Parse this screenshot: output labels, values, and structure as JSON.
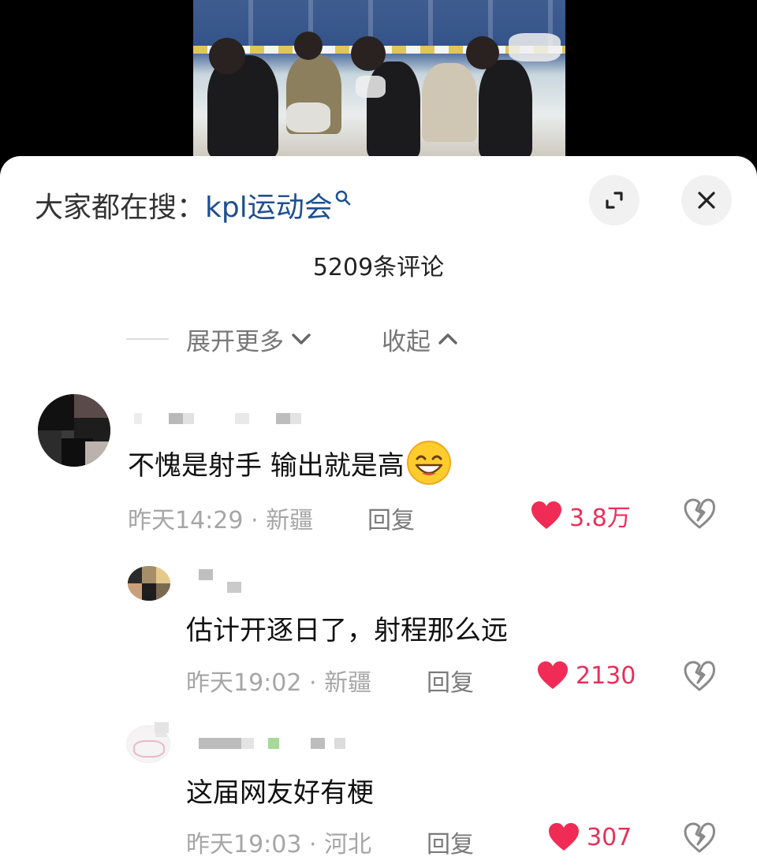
{
  "search_hint": {
    "label": "大家都在搜：",
    "keyword": "kpl运动会"
  },
  "comment_count": "5209条评论",
  "thread": {
    "expand_label": "展开更多",
    "collapse_label": "收起"
  },
  "comments": [
    {
      "text": "不愧是射手 输出就是高",
      "time": "昨天14:29",
      "location": "新疆",
      "reply": "回复",
      "likes": "3.8万"
    },
    {
      "text": "估计开逐日了，射程那么远",
      "time": "昨天19:02",
      "location": "新疆",
      "reply": "回复",
      "likes": "2130"
    },
    {
      "text": "这届网友好有梗",
      "time": "昨天19:03",
      "location": "河北",
      "reply": "回复",
      "likes": "307"
    }
  ],
  "meta_separator": " · ",
  "icons": [
    "search-icon",
    "expand-icon",
    "close-icon",
    "chevron-down-icon",
    "chevron-up-icon",
    "heart-icon",
    "broken-heart-icon",
    "grin-emoji-icon"
  ],
  "colors": {
    "accent_like": "#e8305a",
    "keyword": "#1f4f8f",
    "muted": "#a6a6a6"
  }
}
